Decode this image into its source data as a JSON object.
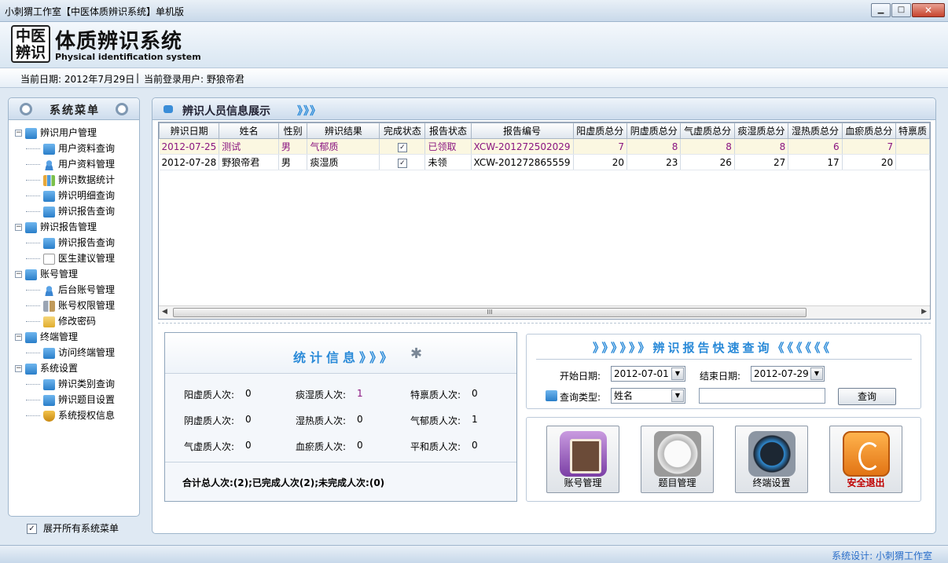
{
  "window": {
    "title": "小刺猬工作室【中医体质辨识系统】单机版",
    "min": "▁",
    "max": "□",
    "close": "✕"
  },
  "logo": {
    "mark_line1": "中医",
    "mark_line2": "辨识",
    "title": "体质辨识系统",
    "subtitle": "Physical identification system"
  },
  "info": {
    "date_text": "当前日期: 2012年7月29日",
    "sep": "|",
    "user_text": "当前登录用户: 野狼帝君"
  },
  "sidebar": {
    "title": "系统菜单",
    "groups": [
      {
        "label": "辨识用户管理",
        "items": [
          "用户资料查询",
          "用户资料管理",
          "辨识数据统计",
          "辨识明细查询",
          "辨识报告查询"
        ]
      },
      {
        "label": "辨识报告管理",
        "items": [
          "辨识报告查询",
          "医生建议管理"
        ]
      },
      {
        "label": "账号管理",
        "items": [
          "后台账号管理",
          "账号权限管理",
          "修改密码"
        ]
      },
      {
        "label": "终端管理",
        "items": [
          "访问终端管理"
        ]
      },
      {
        "label": "系统设置",
        "items": [
          "辨识类别查询",
          "辨识题目设置",
          "系统授权信息"
        ]
      }
    ],
    "expand_all_label": "展开所有系统菜单",
    "expand_all_checked": true
  },
  "main": {
    "title": "辨识人员信息展示",
    "arrows": "》》》"
  },
  "grid": {
    "columns": [
      "辨识日期",
      "姓名",
      "性别",
      "辨识结果",
      "完成状态",
      "报告状态",
      "报告编号",
      "阳虚质总分",
      "阴虚质总分",
      "气虚质总分",
      "痰湿质总分",
      "湿热质总分",
      "血瘀质总分",
      "特禀质"
    ],
    "rows": [
      {
        "date": "2012-07-25",
        "name": "测试",
        "sex": "男",
        "result": "气郁质",
        "done": true,
        "report": "已领取",
        "code": "XCW-201272502029",
        "yang": "7",
        "yin": "8",
        "qi": "8",
        "tan": "8",
        "shi": "6",
        "xue": "7",
        "te": ""
      },
      {
        "date": "2012-07-28",
        "name": "野狼帝君",
        "sex": "男",
        "result": "痰湿质",
        "done": true,
        "report": "未领",
        "code": "XCW-201272865559",
        "yang": "20",
        "yin": "23",
        "qi": "26",
        "tan": "27",
        "shi": "17",
        "xue": "20",
        "te": ""
      }
    ],
    "scroll_left": "◀",
    "scroll_right": "▶",
    "thumb_grip": "III"
  },
  "stats": {
    "title": "统计信息》》》",
    "items": [
      {
        "label": "阳虚质人次:",
        "value": "0"
      },
      {
        "label": "痰湿质人次:",
        "value": "1"
      },
      {
        "label": "特禀质人次:",
        "value": "0"
      },
      {
        "label": "阴虚质人次:",
        "value": "0"
      },
      {
        "label": "湿热质人次:",
        "value": "0"
      },
      {
        "label": "气郁质人次:",
        "value": "1"
      },
      {
        "label": "气虚质人次:",
        "value": "0"
      },
      {
        "label": "血瘀质人次:",
        "value": "0"
      },
      {
        "label": "平和质人次:",
        "value": "0"
      }
    ],
    "total": "合计总人次:(2);已完成人次(2);未完成人次:(0)"
  },
  "query": {
    "title": "》》》》》》辨识报告快速查询《《《《《《",
    "start_label": "开始日期:",
    "start_value": "2012-07-01",
    "end_label": "结束日期:",
    "end_value": "2012-07-29",
    "type_label": "查询类型:",
    "type_value": "姓名",
    "keyword_value": "",
    "button": "查询"
  },
  "tiles": [
    {
      "label": "账号管理"
    },
    {
      "label": "题目管理"
    },
    {
      "label": "终端设置"
    },
    {
      "label": "安全退出"
    }
  ],
  "footer": {
    "text": "系统设计: 小刺猬工作室"
  },
  "colors": {
    "accent": "#2a8ad8",
    "selected_row_text": "#8a1580",
    "exit_text": "#c00000"
  }
}
